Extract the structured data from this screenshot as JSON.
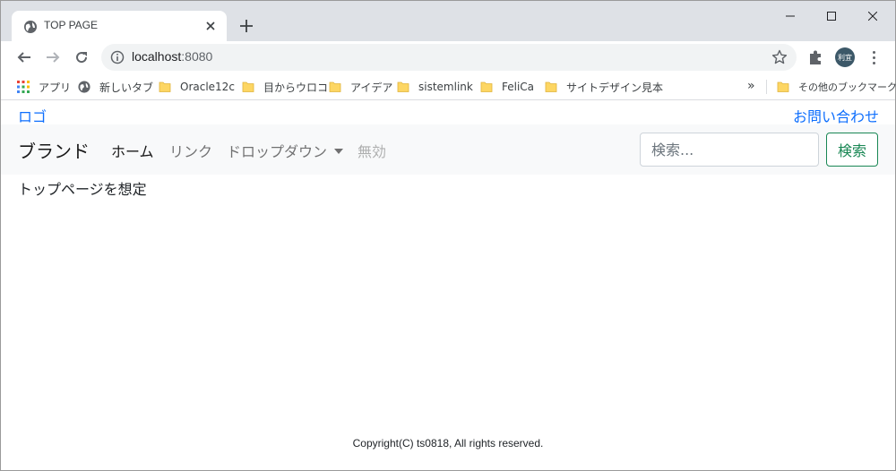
{
  "browser": {
    "tab": {
      "title": "TOP PAGE"
    },
    "address": {
      "host": "localhost",
      "port": ":8080"
    },
    "profile_initials": "利宜",
    "bookmarks": [
      {
        "label": "アプリ"
      },
      {
        "label": "新しいタブ"
      },
      {
        "label": "Oracle12c"
      },
      {
        "label": "目からウロコ"
      },
      {
        "label": "アイデア"
      },
      {
        "label": "sistemlink"
      },
      {
        "label": "FeliCa"
      },
      {
        "label": "サイトデザイン見本"
      }
    ],
    "more_chevron": "»",
    "other_bookmarks": "その他のブックマーク"
  },
  "page": {
    "logo_link": "ロゴ",
    "contact_link": "お問い合わせ",
    "navbar": {
      "brand": "ブランド",
      "items": [
        {
          "label": "ホーム",
          "state": "active"
        },
        {
          "label": "リンク",
          "state": "normal"
        },
        {
          "label": "ドロップダウン",
          "state": "dropdown"
        },
        {
          "label": "無効",
          "state": "disabled"
        }
      ],
      "search_placeholder": "検索...",
      "search_button": "検索"
    },
    "content": "トップページを想定",
    "footer": "Copyright(C) ts0818, All rights reserved."
  },
  "colors": {
    "link": "#0d6efd",
    "success": "#198754",
    "navbar_bg": "#f8f9fa",
    "tabstrip_bg": "#dee1e6"
  }
}
